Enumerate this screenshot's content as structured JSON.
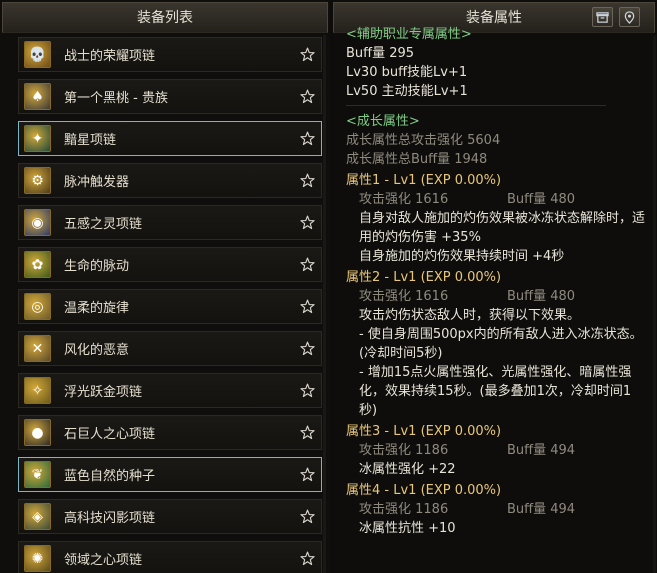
{
  "left": {
    "title": "装备列表",
    "items": [
      {
        "name": "战士的荣耀项链",
        "icon": "💀",
        "bg": "#6b4a18",
        "selected": false
      },
      {
        "name": "第一个黑桃 - 贵族",
        "icon": "♠",
        "bg": "#3a3a3a",
        "selected": false
      },
      {
        "name": "黯星项链",
        "icon": "✦",
        "bg": "#1f4a3a",
        "selected": true
      },
      {
        "name": "脉冲触发器",
        "icon": "⚙",
        "bg": "#4a3a1a",
        "selected": false
      },
      {
        "name": "五感之灵项链",
        "icon": "◉",
        "bg": "#2a3a6a",
        "selected": false
      },
      {
        "name": "生命的脉动",
        "icon": "✿",
        "bg": "#3a5a1a",
        "selected": false
      },
      {
        "name": "温柔的旋律",
        "icon": "◎",
        "bg": "#6a5a2a",
        "selected": false
      },
      {
        "name": "风化的恶意",
        "icon": "✕",
        "bg": "#5a4a2a",
        "selected": false
      },
      {
        "name": "浮光跃金项链",
        "icon": "✧",
        "bg": "#6a5a1a",
        "selected": false
      },
      {
        "name": "石巨人之心项链",
        "icon": "●",
        "bg": "#2a2a2a",
        "selected": false
      },
      {
        "name": "蓝色自然的种子",
        "icon": "❦",
        "bg": "#2a6a3a",
        "selected": true
      },
      {
        "name": "高科技闪影项链",
        "icon": "◈",
        "bg": "#3a4a3a",
        "selected": false
      },
      {
        "name": "领域之心项链",
        "icon": "✺",
        "bg": "#5a4a1a",
        "selected": false
      }
    ],
    "star_icon": "star-outline-icon"
  },
  "right": {
    "title": "装备属性",
    "buttons": [
      {
        "icon": "archive-icon"
      },
      {
        "icon": "location-pin-icon"
      }
    ],
    "top_section_title": "<辅助职业专属属性>",
    "top_lines": [
      "Buff量  295",
      "Lv30 buff技能Lv+1",
      "Lv50 主动技能Lv+1"
    ],
    "growth_title": "<成长属性>",
    "growth_totals": [
      "成长属性总攻击强化 5604",
      "成长属性总Buff量 1948"
    ],
    "attributes": [
      {
        "title": "属性1 - Lv1 (EXP 0.00%)",
        "attack": "攻击强化   1616",
        "buff": "Buff量   480",
        "effects": [
          "自身对敌人施加的灼伤效果被冰冻状态解除时，适用的灼伤伤害 +35%",
          "自身施加的灼伤效果持续时间 +4秒"
        ]
      },
      {
        "title": "属性2 - Lv1 (EXP 0.00%)",
        "attack": "攻击强化   1616",
        "buff": "Buff量   480",
        "effects": [
          "攻击灼伤状态敌人时，获得以下效果。",
          "- 使自身周围500px内的所有敌人进入冰冻状态。(冷却时间5秒)",
          "- 增加15点火属性强化、光属性强化、暗属性强化，效果持续15秒。(最多叠加1次，冷却时间1秒)"
        ]
      },
      {
        "title": "属性3 - Lv1 (EXP 0.00%)",
        "attack": "攻击强化   1186",
        "buff": "Buff量   494",
        "effects": [
          "冰属性强化 +22"
        ]
      },
      {
        "title": "属性4 - Lv1 (EXP 0.00%)",
        "attack": "攻击强化   1186",
        "buff": "Buff量   494",
        "effects": [
          "冰属性抗性 +10"
        ]
      }
    ]
  },
  "colors": {
    "green": "#7fce86",
    "yellow": "#e8c77a",
    "gray": "#8f8a7e",
    "select_border": "#7ab7c4"
  }
}
